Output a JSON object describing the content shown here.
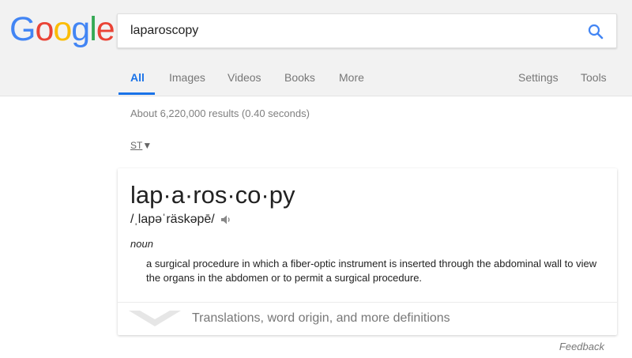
{
  "logo": {
    "letters": [
      "G",
      "o",
      "o",
      "g",
      "l",
      "e"
    ],
    "colors": [
      "#4285F4",
      "#EA4335",
      "#FBBC05",
      "#4285F4",
      "#34A853",
      "#EA4335"
    ]
  },
  "search": {
    "value": "laparoscopy",
    "icon": "magnifier-icon",
    "icon_color": "#4285F4"
  },
  "tabs": {
    "all": "All",
    "images": "Images",
    "videos": "Videos",
    "books": "Books",
    "more": "More",
    "settings": "Settings",
    "tools": "Tools",
    "active_color": "#1a73e8"
  },
  "results": {
    "stats": "About 6,220,000 results (0.40 seconds)",
    "lang_code": "ST",
    "lang_arrow": "▼"
  },
  "definition": {
    "word": "lap·a·ros·co·py",
    "phonetic": "/ˌlapəˈräskəpē/",
    "part_of_speech": "noun",
    "meaning": "a surgical procedure in which a fiber-optic instrument is inserted through the abdominal wall to view the organs in the abdomen or to permit a surgical procedure.",
    "more_label": "Translations, word origin, and more definitions"
  },
  "footer": {
    "feedback": "Feedback"
  }
}
